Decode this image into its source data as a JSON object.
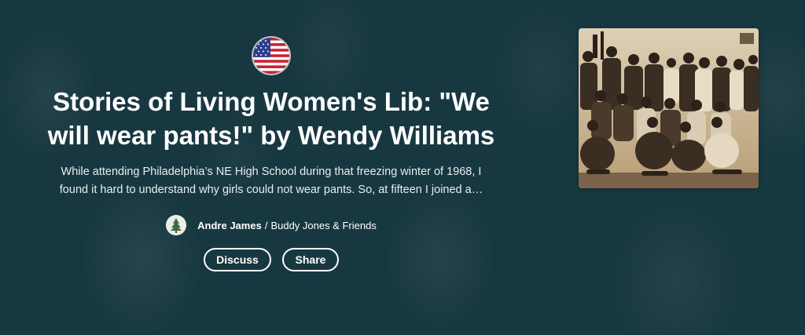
{
  "story": {
    "title": "Stories of Living Women's Lib: \"We will wear pants!\" by Wendy Williams",
    "description": "While attending Philadelphia’s NE High School during that freezing winter of 1968, I found it hard to understand why girls could not wear pants. So, at fifteen I joined a…",
    "author": "Andre James",
    "separator": "/",
    "group": "Buddy Jones & Friends"
  },
  "actions": {
    "discuss_label": "Discuss",
    "share_label": "Share"
  },
  "icons": {
    "flag": "us-flag-icon",
    "avatar": "tree-avatar-icon"
  },
  "colors": {
    "background": "#1d3d45",
    "text": "#ffffff",
    "photo_sepia": "#c9b08a"
  }
}
